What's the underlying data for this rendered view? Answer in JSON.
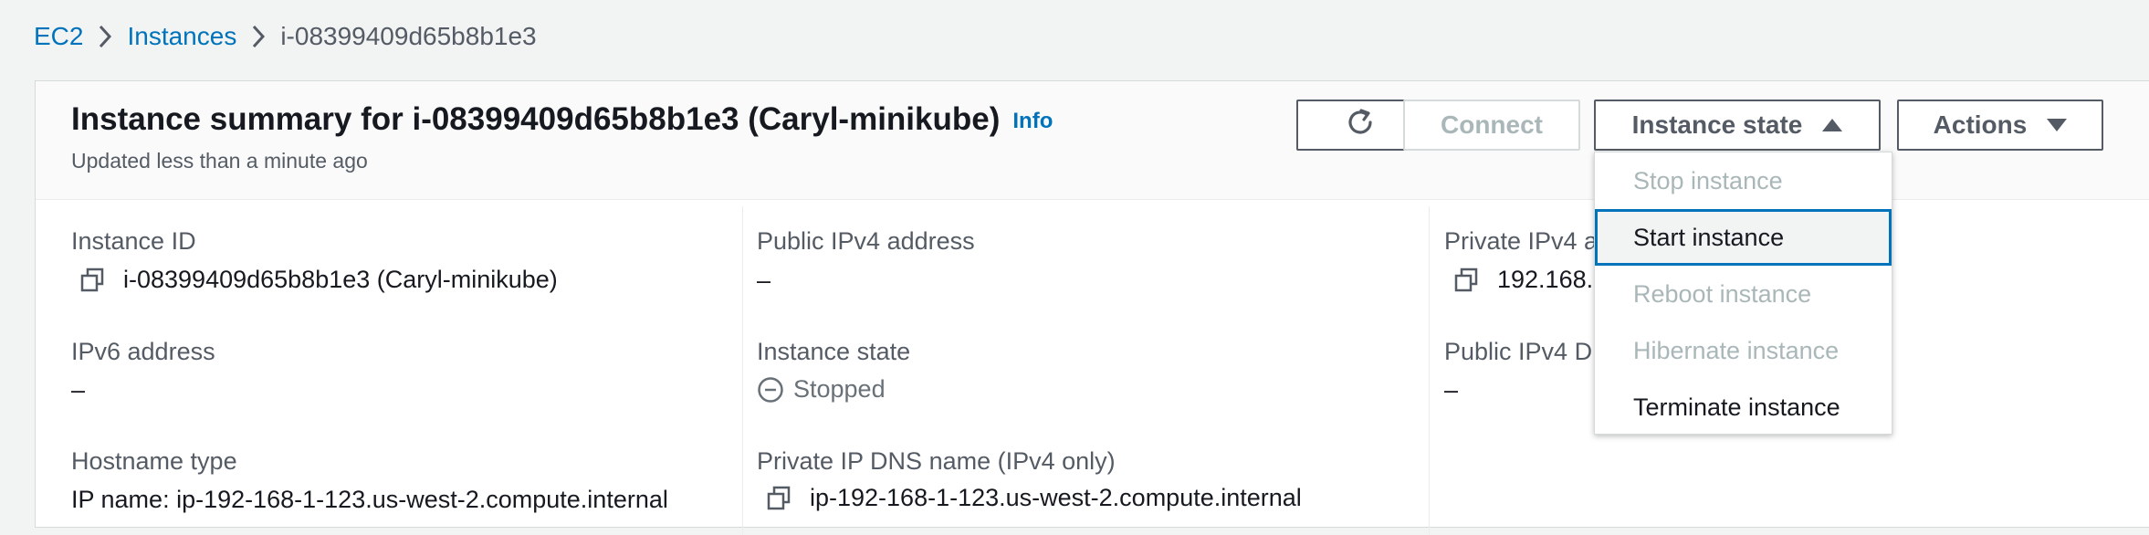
{
  "breadcrumb": {
    "items": [
      "EC2",
      "Instances"
    ],
    "current": "i-08399409d65b8b1e3"
  },
  "header": {
    "title": "Instance summary for i-08399409d65b8b1e3 (Caryl-minikube)",
    "info": "Info",
    "subtitle": "Updated less than a minute ago",
    "buttons": {
      "connect": "Connect",
      "instance_state": "Instance state",
      "actions": "Actions"
    }
  },
  "fields": {
    "instance_id": {
      "label": "Instance ID",
      "value": "i-08399409d65b8b1e3 (Caryl-minikube)"
    },
    "public_ipv4": {
      "label": "Public IPv4 address",
      "value": "–"
    },
    "private_ipv4": {
      "label": "Private IPv4 a",
      "value": "192.168."
    },
    "ipv6": {
      "label": "IPv6 address",
      "value": "–"
    },
    "instance_state": {
      "label": "Instance state",
      "value": "Stopped"
    },
    "public_dns": {
      "label": "Public IPv4 D",
      "value": "–"
    },
    "hostname_type": {
      "label": "Hostname type",
      "value": "IP name: ip-192-168-1-123.us-west-2.compute.internal"
    },
    "private_dns": {
      "label": "Private IP DNS name (IPv4 only)",
      "value": "ip-192-168-1-123.us-west-2.compute.internal"
    }
  },
  "dropdown": {
    "items": [
      {
        "label": "Stop instance",
        "state": "disabled"
      },
      {
        "label": "Start instance",
        "state": "selected"
      },
      {
        "label": "Reboot instance",
        "state": "disabled"
      },
      {
        "label": "Hibernate instance",
        "state": "disabled"
      },
      {
        "label": "Terminate instance",
        "state": "enabled"
      }
    ]
  },
  "icons": {
    "refresh": "refresh-icon",
    "copy": "copy-icon",
    "stopped": "stopped-status-icon",
    "breadcrumb_separator": "chevron-right-icon"
  },
  "colors": {
    "link": "#0073bb",
    "text": "#16191f",
    "muted": "#545b64",
    "disabled": "#aab7b8",
    "focus": "#0073bb"
  }
}
